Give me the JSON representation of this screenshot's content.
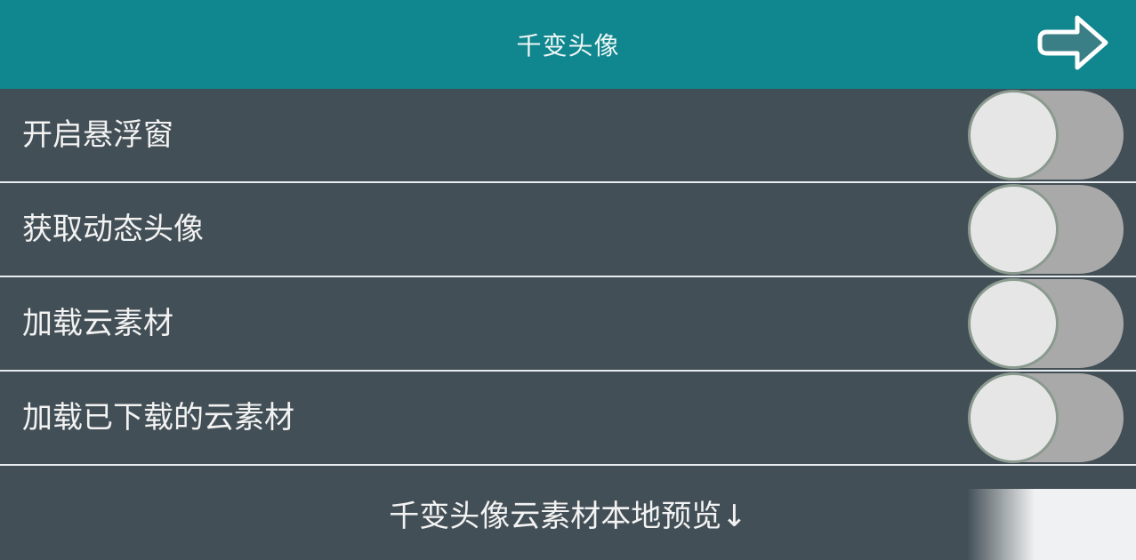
{
  "header": {
    "title": "千变头像",
    "back_icon": "arrow-right-icon"
  },
  "settings": [
    {
      "label": "开启悬浮窗",
      "enabled": false
    },
    {
      "label": "获取动态头像",
      "enabled": false
    },
    {
      "label": "加载云素材",
      "enabled": false
    },
    {
      "label": "加载已下载的云素材",
      "enabled": false
    }
  ],
  "footer": {
    "label": "千变头像云素材本地预览↓"
  },
  "colors": {
    "header_bg": "#10868e",
    "body_bg": "#434f56",
    "toggle_track": "#a9a9a9",
    "toggle_knob": "#e6e6e6",
    "divider": "#e9eef0"
  }
}
